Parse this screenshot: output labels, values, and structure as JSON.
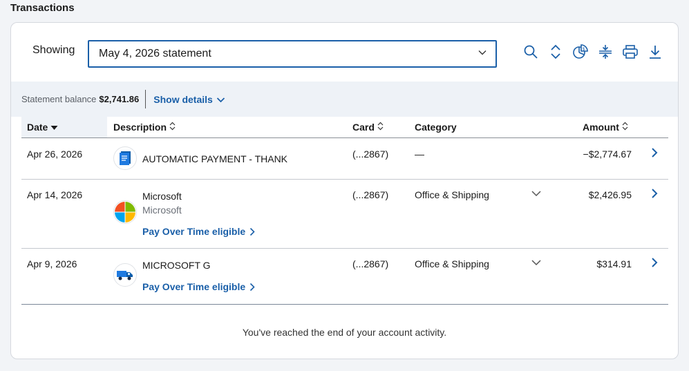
{
  "section_title": "Transactions",
  "toolbar": {
    "showing_label": "Showing",
    "statement_selected": "May 4, 2026 statement",
    "tools": [
      "search-icon",
      "sort-icon",
      "spending-chart-icon",
      "collapse-icon",
      "print-icon",
      "download-icon"
    ]
  },
  "balance": {
    "label": "Statement balance",
    "value": "$2,741.86",
    "show_details": "Show details"
  },
  "table": {
    "headers": {
      "date": "Date",
      "description": "Description",
      "card": "Card",
      "category": "Category",
      "amount": "Amount"
    },
    "rows": [
      {
        "date": "Apr 26, 2026",
        "merchant": "AUTOMATIC PAYMENT - THANK",
        "merchant_sub": "",
        "pay_over_time": "",
        "card": "(...2867)",
        "category": "—",
        "amount": "−$2,774.67",
        "icon": "payment-document-icon"
      },
      {
        "date": "Apr 14, 2026",
        "merchant": "Microsoft",
        "merchant_sub": "Microsoft",
        "pay_over_time": "Pay Over Time eligible",
        "card": "(...2867)",
        "category": "Office & Shipping",
        "amount": "$2,426.95",
        "icon": "microsoft-logo-icon"
      },
      {
        "date": "Apr 9, 2026",
        "merchant": "MICROSOFT G",
        "merchant_sub": "",
        "pay_over_time": "Pay Over Time eligible",
        "card": "(...2867)",
        "category": "Office & Shipping",
        "amount": "$314.91",
        "icon": "delivery-truck-icon"
      }
    ]
  },
  "footer_note": "You've reached the end of your account activity.",
  "colors": {
    "accent": "#1a5fa8",
    "balance_bar_bg": "#eef2f7",
    "page_bg": "#f2f4f7"
  }
}
